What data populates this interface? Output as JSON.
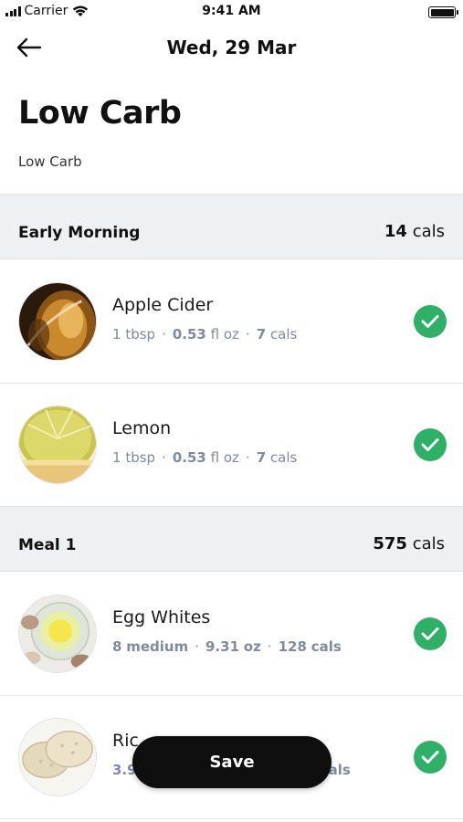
{
  "status_bar": {
    "carrier": "Carrier",
    "time": "9:41 AM"
  },
  "nav": {
    "title": "Wed, 29 Mar",
    "back_icon": "arrow-left-icon"
  },
  "plan": {
    "title": "Low Carb",
    "subtitle": "Low Carb"
  },
  "sections": [
    {
      "name": "Early Morning",
      "cals_value": "14",
      "cals_unit": "cals",
      "items": [
        {
          "name": "Apple Cider",
          "amount": "1",
          "amount_unit": "tbsp",
          "weight": "0.53",
          "weight_unit": "fl oz",
          "cals": "7",
          "cals_unit": "cals",
          "checked": true
        },
        {
          "name": "Lemon",
          "amount": "1",
          "amount_unit": "tbsp",
          "weight": "0.53",
          "weight_unit": "fl oz",
          "cals": "7",
          "cals_unit": "cals",
          "checked": true
        }
      ]
    },
    {
      "name": "Meal 1",
      "cals_value": "575",
      "cals_unit": "cals",
      "items": [
        {
          "name": "Egg Whites",
          "amount": "8",
          "amount_unit": "medium",
          "weight": "9.31",
          "weight_unit": "oz",
          "cals": "128",
          "cals_unit": "cals",
          "checked": true
        },
        {
          "name": "Ric",
          "amount": "3.9",
          "amount_unit": "",
          "weight": "",
          "weight_unit": "",
          "cals": "",
          "cals_unit": "als",
          "checked": true
        }
      ]
    }
  ],
  "save_button": {
    "label": "Save"
  },
  "colors": {
    "check_green": "#2eb067",
    "section_bg": "#eef1f4",
    "meta_text": "#7e8ba0"
  }
}
